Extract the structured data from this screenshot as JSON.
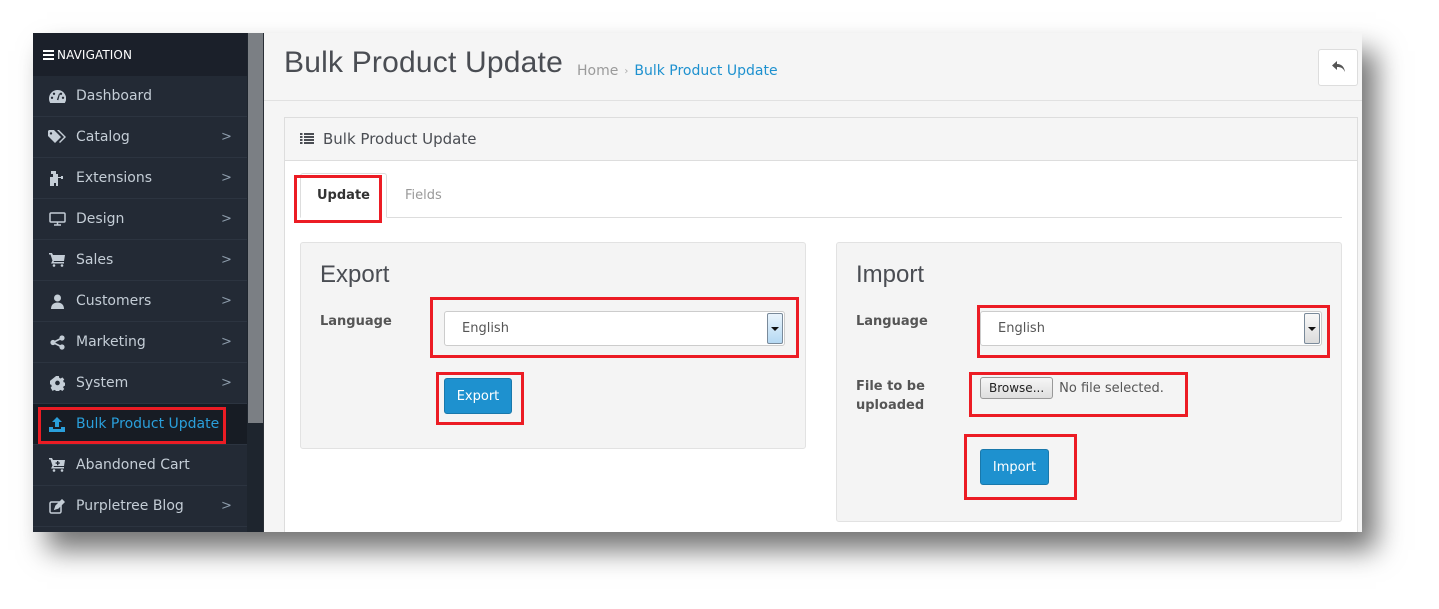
{
  "sidebar": {
    "heading": "NAVIGATION",
    "items": [
      {
        "label": "Dashboard",
        "icon": "dashboard-icon",
        "has_children": false
      },
      {
        "label": "Catalog",
        "icon": "tags-icon",
        "has_children": true
      },
      {
        "label": "Extensions",
        "icon": "puzzle-piece-icon",
        "has_children": true
      },
      {
        "label": "Design",
        "icon": "desktop-icon",
        "has_children": true
      },
      {
        "label": "Sales",
        "icon": "shopping-cart-icon",
        "has_children": true
      },
      {
        "label": "Customers",
        "icon": "user-icon",
        "has_children": true
      },
      {
        "label": "Marketing",
        "icon": "share-alt-icon",
        "has_children": true
      },
      {
        "label": "System",
        "icon": "cog-icon",
        "has_children": true
      },
      {
        "label": "Bulk Product Update",
        "icon": "upload-icon",
        "has_children": false,
        "active": true
      },
      {
        "label": "Abandoned Cart",
        "icon": "cart-plus-icon",
        "has_children": false
      },
      {
        "label": "Purpletree Blog",
        "icon": "edit-icon",
        "has_children": true
      }
    ],
    "chevron": ">"
  },
  "header": {
    "title": "Bulk Product Update",
    "breadcrumb": {
      "home": "Home",
      "separator": "›",
      "current": "Bulk Product Update"
    },
    "back_button_icon": "reply-icon"
  },
  "panel": {
    "heading": "Bulk Product Update",
    "heading_icon": "list-icon",
    "tabs": [
      {
        "label": "Update",
        "active": true
      },
      {
        "label": "Fields",
        "active": false
      }
    ]
  },
  "export": {
    "title": "Export",
    "language_label": "Language",
    "language_value": "English",
    "button_label": "Export"
  },
  "import": {
    "title": "Import",
    "language_label": "Language",
    "language_value": "English",
    "file_label_line1": "File to be",
    "file_label_line2": "uploaded",
    "browse_label": "Browse...",
    "file_status": "No file selected.",
    "button_label": "Import"
  },
  "colors": {
    "sidebar_bg": "#232a35",
    "accent": "#1e91cf",
    "highlight": "#ec1c24"
  }
}
